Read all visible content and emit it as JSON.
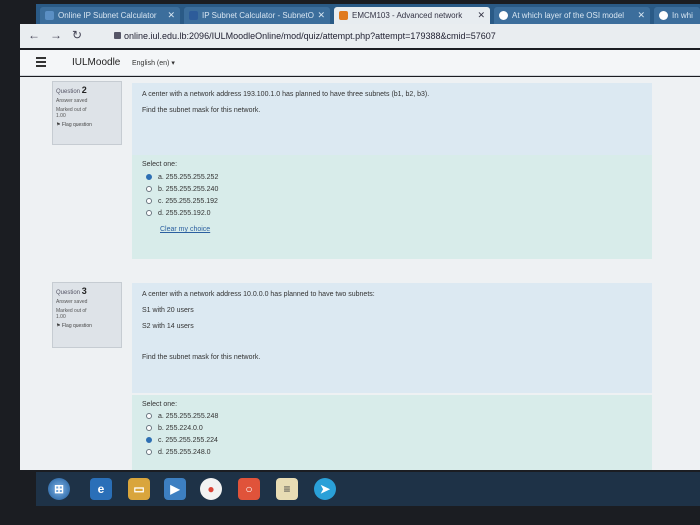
{
  "browser": {
    "tabs": [
      {
        "label": "Online IP Subnet Calculator",
        "active": false
      },
      {
        "label": "IP Subnet Calculator - SubnetO",
        "active": false
      },
      {
        "label": "EMCM103 - Advanced network",
        "active": true
      },
      {
        "label": "At which layer of the OSI model",
        "active": false
      },
      {
        "label": "In whi",
        "active": false
      }
    ],
    "url": "online.iul.edu.lb:2096/IULMoodleOnline/mod/quiz/attempt.php?attempt=179388&cmid=57607"
  },
  "moodle": {
    "brand": "IULMoodle",
    "language": "English (en)"
  },
  "questions": [
    {
      "info": {
        "label": "Question",
        "number": "2",
        "status": "Answer saved",
        "marked": "Marked out of",
        "marks": "1.00",
        "flag": "Flag question"
      },
      "text": [
        "A center with a network address 193.100.1.0 has planned to have three subnets (b1, b2, b3).",
        "Find the subnet mask for this network."
      ],
      "select_label": "Select one:",
      "options": [
        {
          "label": "a. 255.255.255.252",
          "checked": true
        },
        {
          "label": "b. 255.255.255.240",
          "checked": false
        },
        {
          "label": "c. 255.255.255.192",
          "checked": false
        },
        {
          "label": "d. 255.255.192.0",
          "checked": false
        }
      ],
      "clear": "Clear my choice"
    },
    {
      "info": {
        "label": "Question",
        "number": "3",
        "status": "Answer saved",
        "marked": "Marked out of",
        "marks": "1.00",
        "flag": "Flag question"
      },
      "text": [
        "A center with a network address 10.0.0.0 has planned to have two subnets:",
        "S1 with 20 users",
        "S2 with 14 users",
        "Find the subnet mask for this network."
      ],
      "select_label": "Select one:",
      "options": [
        {
          "label": "a. 255.255.255.248",
          "checked": false
        },
        {
          "label": "b. 255.224.0.0",
          "checked": false
        },
        {
          "label": "c. 255.255.255.224",
          "checked": true
        },
        {
          "label": "d. 255.255.248.0",
          "checked": false
        }
      ]
    }
  ],
  "taskbar": {
    "icons": [
      "start-orb",
      "internet-explorer",
      "file-explorer",
      "media-player",
      "chrome",
      "office",
      "notes",
      "telegram"
    ]
  }
}
